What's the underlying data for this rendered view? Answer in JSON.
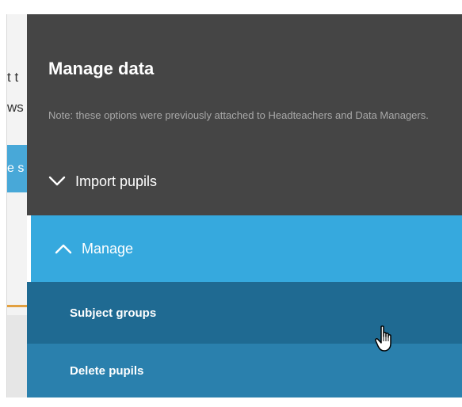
{
  "background_page": {
    "line1_fragment": "t t",
    "line2_fragment": "ws",
    "button_fragment": "e s"
  },
  "menu": {
    "title": "Manage data",
    "note": "Note: these options were previously attached to Headteachers and Data Managers.",
    "sections": [
      {
        "label": "Import pupils",
        "state": "collapsed",
        "icon": "chevron-down-icon"
      },
      {
        "label": "Manage",
        "state": "expanded",
        "icon": "chevron-up-icon"
      }
    ],
    "manage_items": [
      {
        "label": "Subject groups",
        "hovered": true
      },
      {
        "label": "Delete pupils",
        "hovered": false
      }
    ]
  },
  "colors": {
    "panel_bg": "#454545",
    "active_section": "#36a9de",
    "hover_item": "#1f6a92",
    "item": "#2a80ad"
  },
  "cursor": "hand-pointer-icon"
}
